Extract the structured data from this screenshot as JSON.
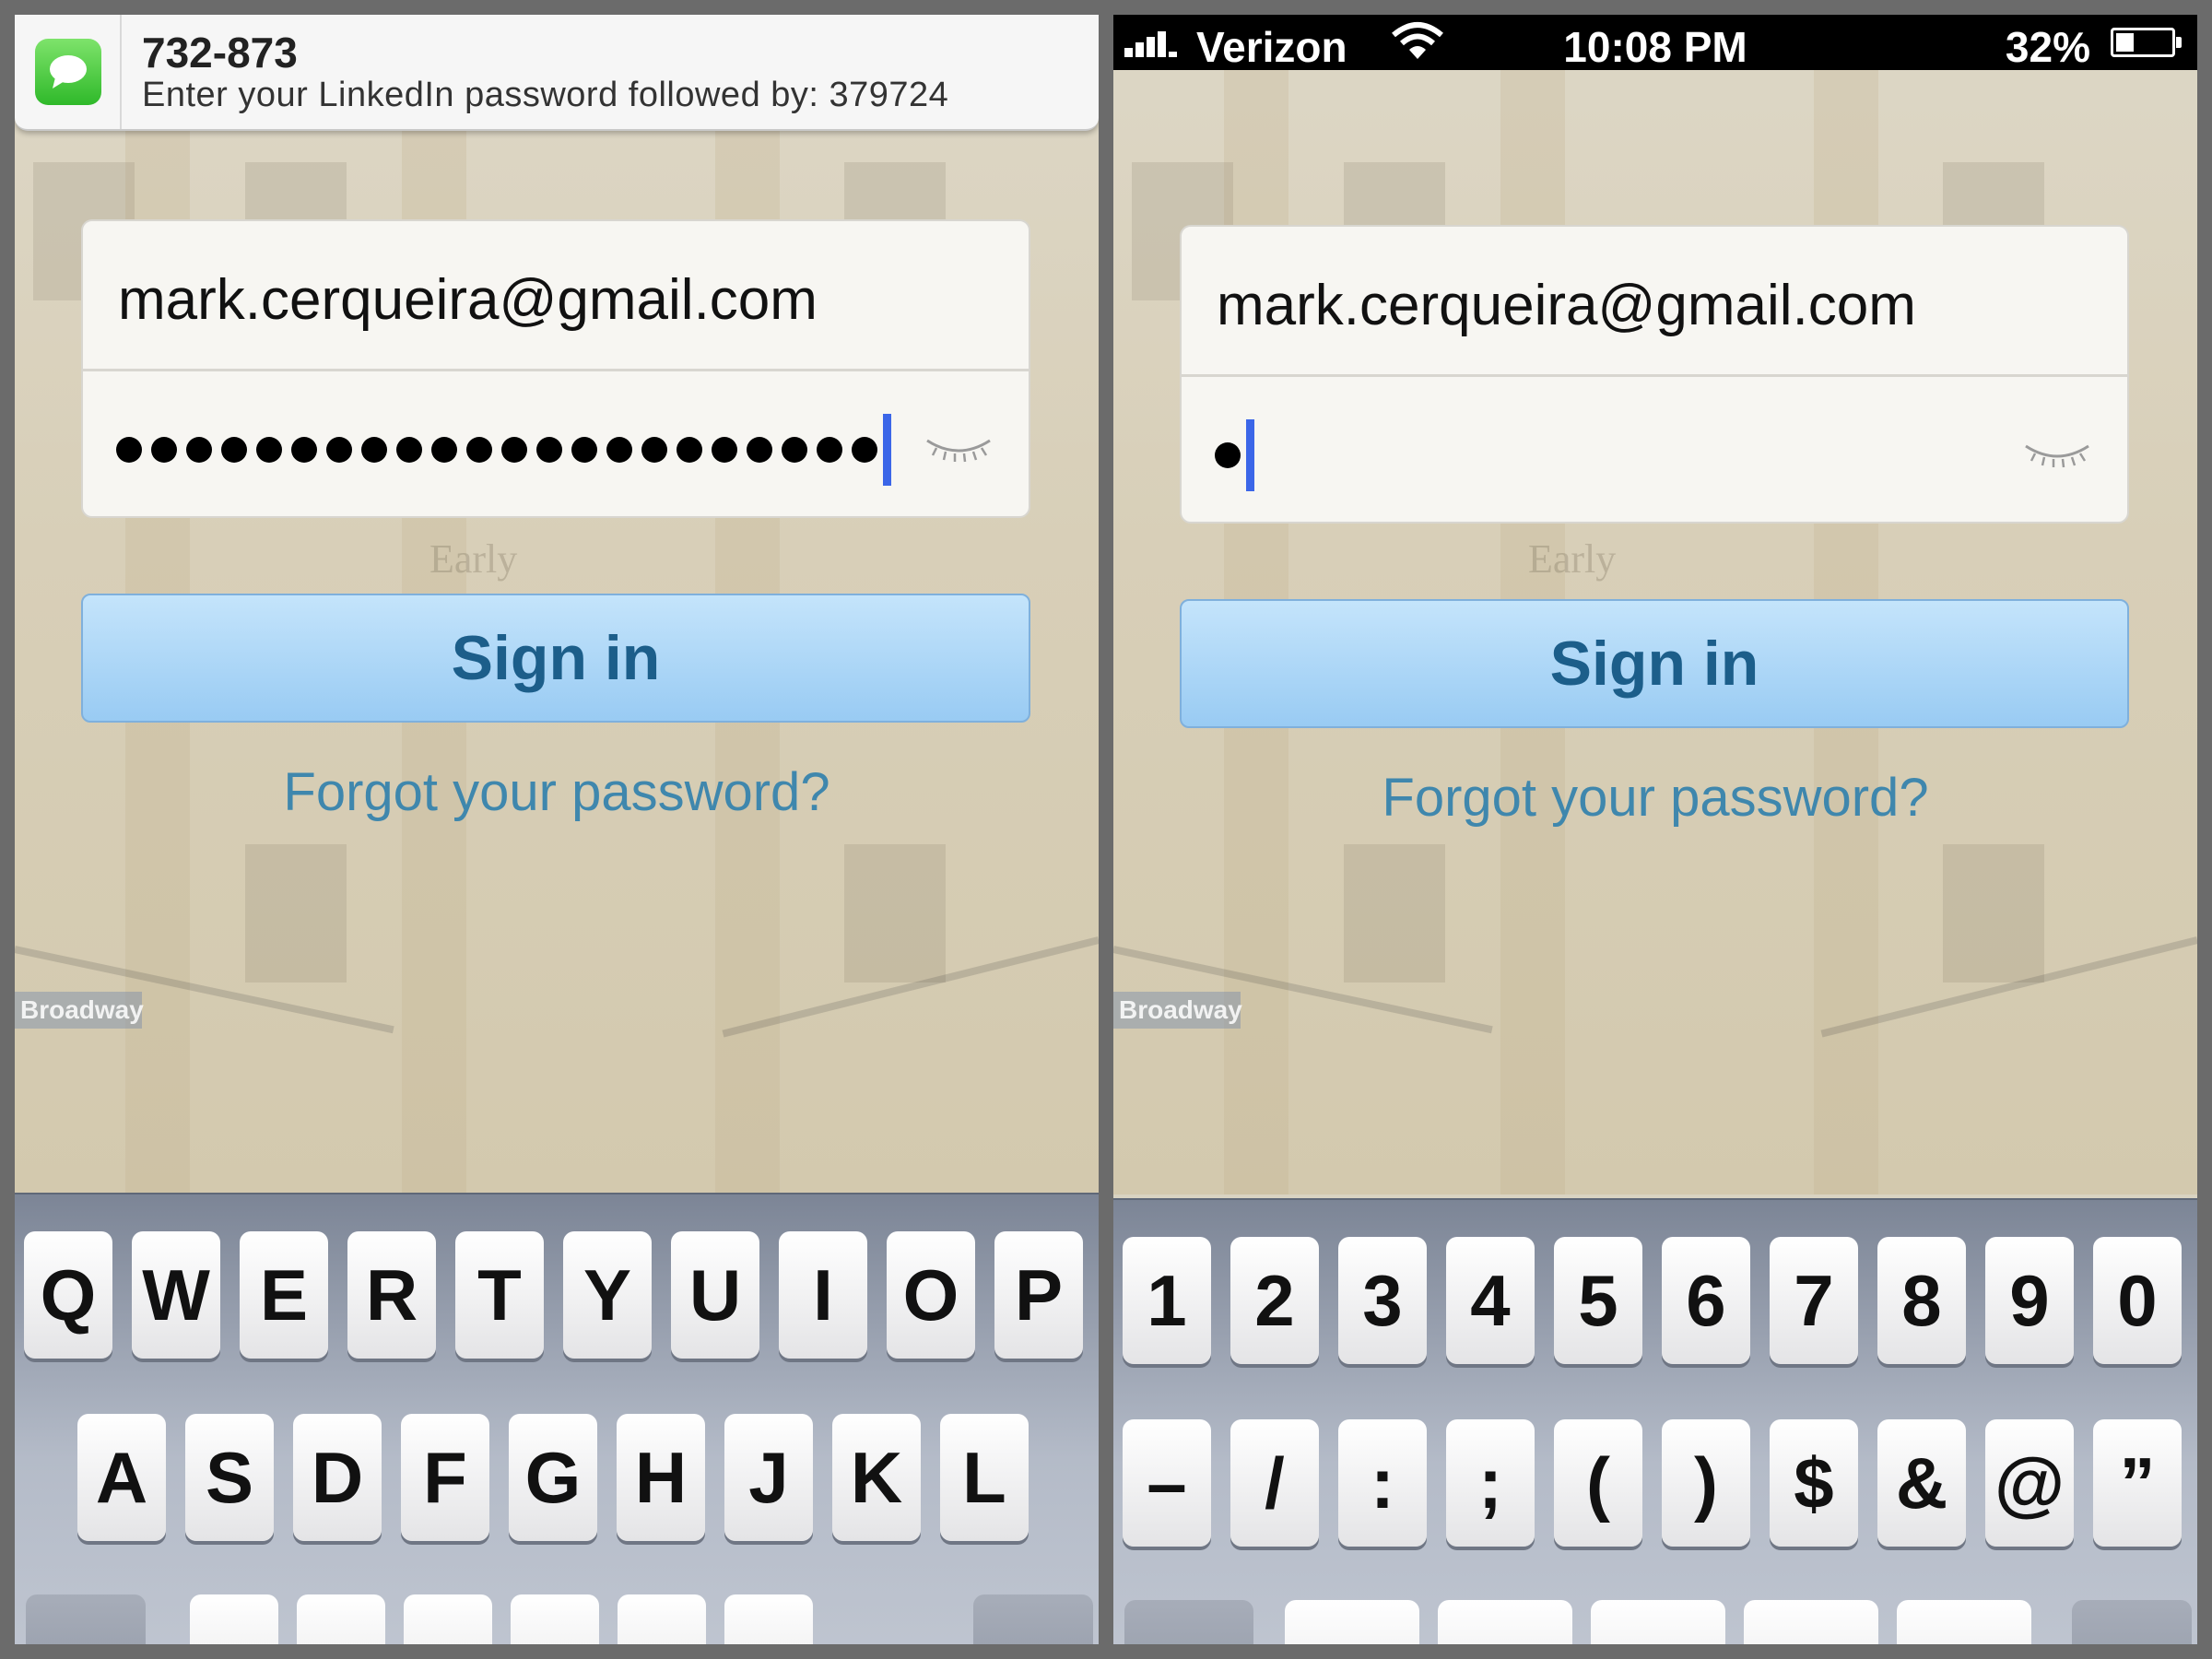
{
  "left_screen": {
    "notification": {
      "sender": "732-873",
      "message": "Enter your LinkedIn password followed by: 379724"
    },
    "form": {
      "email": "mark.cerqueira@gmail.com",
      "password_masked": "••••••••••••••••••••••",
      "password_dot_count": 22
    },
    "sign_in_label": "Sign in",
    "forgot_label": "Forgot your password?",
    "background_sign": "Broadway",
    "background_text": "Early",
    "keyboard": {
      "row1": [
        "Q",
        "W",
        "E",
        "R",
        "T",
        "Y",
        "U",
        "I",
        "O",
        "P"
      ],
      "row2": [
        "A",
        "S",
        "D",
        "F",
        "G",
        "H",
        "J",
        "K",
        "L"
      ]
    }
  },
  "right_screen": {
    "status_bar": {
      "carrier": "Verizon",
      "time": "10:08 PM",
      "battery": "32%",
      "battery_level": 0.32
    },
    "form": {
      "email": "mark.cerqueira@gmail.com",
      "password_masked": "•",
      "password_dot_count": 1
    },
    "sign_in_label": "Sign in",
    "forgot_label": "Forgot your password?",
    "background_sign": "Broadway",
    "background_text": "Early",
    "keyboard": {
      "row1": [
        "1",
        "2",
        "3",
        "4",
        "5",
        "6",
        "7",
        "8",
        "9",
        "0"
      ],
      "row2": [
        "–",
        "/",
        ":",
        ";",
        "(",
        ")",
        "$",
        "&",
        "@",
        "”"
      ]
    }
  },
  "icons": [
    "messages-icon",
    "signal-bars-icon",
    "wifi-icon",
    "battery-icon",
    "eye-closed-icon",
    "shift-key-icon",
    "delete-key-icon"
  ]
}
